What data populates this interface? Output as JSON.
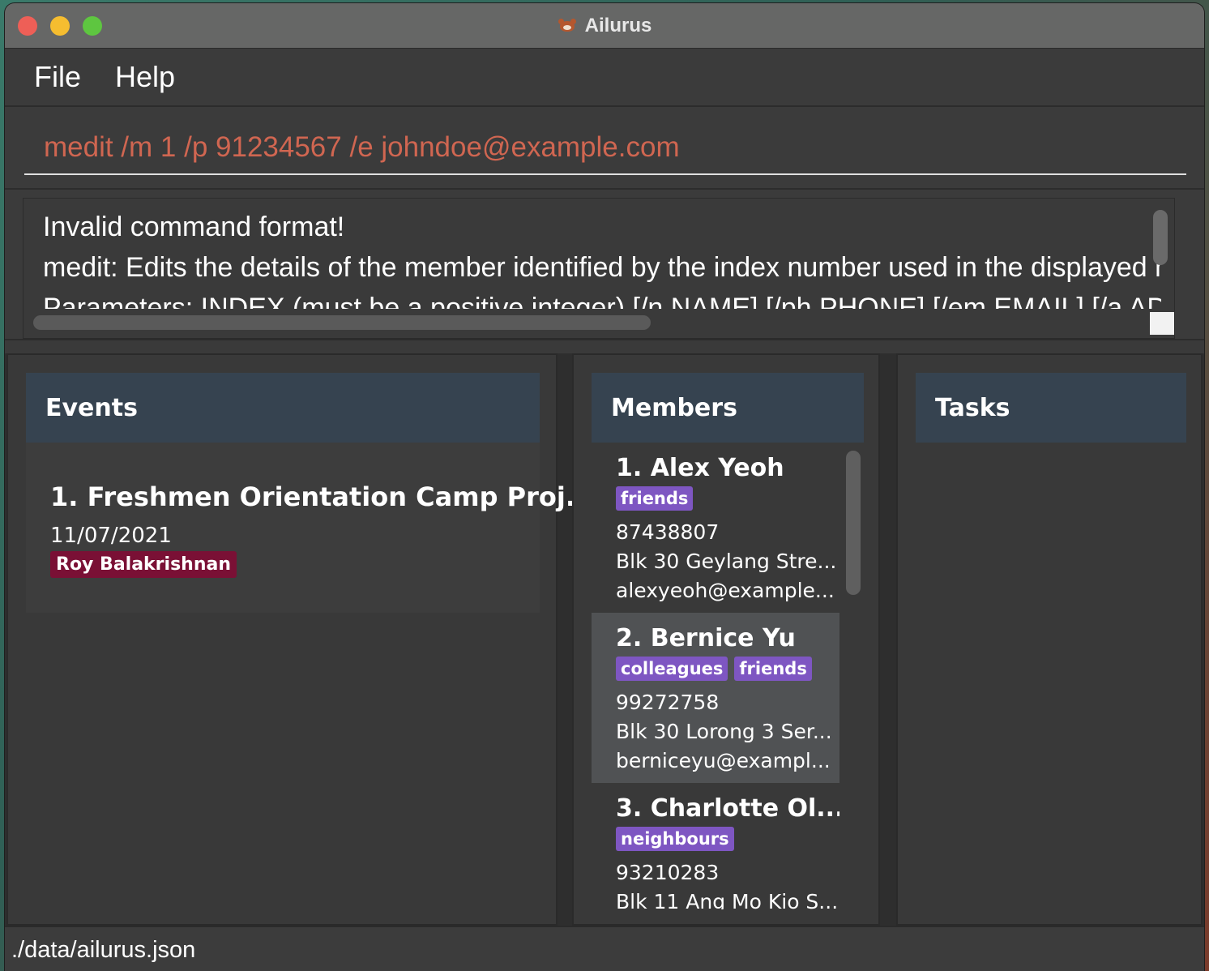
{
  "window": {
    "title": "Ailurus"
  },
  "menu": {
    "file": "File",
    "help": "Help"
  },
  "command": {
    "value": "medit /m 1 /p 91234567 /e johndoe@example.com"
  },
  "result": {
    "lines": [
      "Invalid command format!",
      "medit: Edits the details of the member identified by the index number used in the displayed member list.",
      "Parameters: INDEX (must be a positive integer) [/n NAME] [/ph PHONE] [/em EMAIL] [/a ADDRESS]"
    ]
  },
  "events": {
    "header": "Events",
    "items": [
      {
        "title": "1.  Freshmen Orientation Camp Proj...",
        "date": "11/07/2021",
        "tag": "Roy Balakrishnan"
      }
    ]
  },
  "members": {
    "header": "Members",
    "items": [
      {
        "name": "1.  Alex Yeoh",
        "tags": [
          "friends"
        ],
        "phone": "87438807",
        "address": "Blk 30 Geylang Stre...",
        "email": "alexyeoh@example..."
      },
      {
        "name": "2.  Bernice Yu",
        "tags": [
          "colleagues",
          "friends"
        ],
        "phone": "99272758",
        "address": "Blk 30 Lorong 3 Ser...",
        "email": "berniceyu@exampl..."
      },
      {
        "name": "3.  Charlotte Ol...",
        "tags": [
          "neighbours"
        ],
        "phone": "93210283",
        "address": "Blk 11 Ang Mo Kio S...",
        "email": ""
      }
    ]
  },
  "tasks": {
    "header": "Tasks"
  },
  "status": {
    "path": "./data/ailurus.json"
  },
  "colors": {
    "command_text": "#d06651",
    "member_tag": "#7e56c2",
    "person_tag": "#7a1035",
    "header_bg": "#364350"
  },
  "icons": {
    "app": "red-panda-icon"
  }
}
